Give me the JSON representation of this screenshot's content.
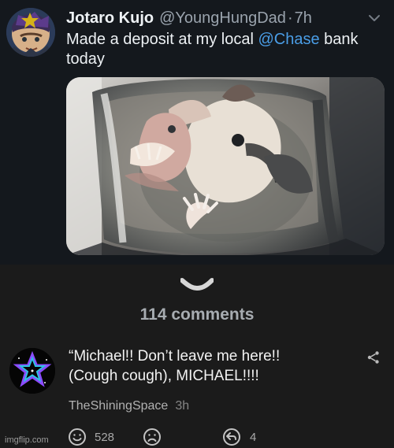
{
  "tweet": {
    "author_name": "Jotaro Kujo",
    "handle": "@YoungHungDad",
    "separator": "·",
    "time": "7h",
    "text_line_one_prefix": "Made a deposit at my local ",
    "mention": "@Chase",
    "text_line_one_suffix": " bank",
    "text_line_two": "today",
    "avatar_icon": "jotaro-avatar-icon",
    "options_icon": "chevron-down-icon",
    "photo_icon": "opossum-photo",
    "mention_color": "#4a9de6"
  },
  "comments": {
    "count_label": "114 comments",
    "collapse_icon": "chevron-down-icon",
    "comment": {
      "text_line_one": "“Michael!! Don’t leave me here!!",
      "text_line_two": "(Cough cough), MICHAEL!!!!",
      "username": "TheShiningSpace",
      "time": "3h",
      "avatar_icon": "star-avatar-icon",
      "share_icon": "share-icon"
    },
    "actions": {
      "like_count": "528",
      "reply_count": "4",
      "like_icon": "smile-face-icon",
      "dislike_icon": "frown-face-icon",
      "reply_icon": "reply-arrow-icon"
    }
  },
  "watermark": "imgflip.com",
  "colors": {
    "tweet_background": "#14181d",
    "comments_background": "#1b1b1b",
    "primary_text": "#eef2f5",
    "muted_text": "#9aa3ad"
  }
}
